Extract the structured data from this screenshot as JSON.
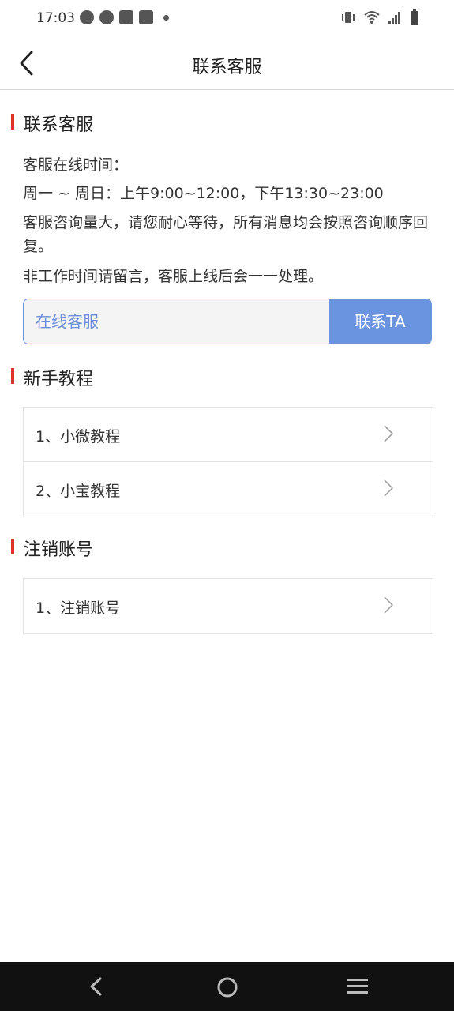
{
  "status_bar": {
    "time": "17:03"
  },
  "header": {
    "title": "联系客服"
  },
  "contact_section": {
    "title": "联系客服",
    "hours_label": "客服在线时间：",
    "hours_value": "周一 ~ 周日：上午9:00~12:00，下午13:30~23:00",
    "notice_1": "客服咨询量大，请您耐心等待，所有消息均会按照咨询顺序回复。",
    "notice_2": "非工作时间请留言，客服上线后会一一处理。",
    "input_placeholder": "在线客服",
    "button_label": "联系TA"
  },
  "tutorial_section": {
    "title": "新手教程",
    "items": [
      {
        "label": "1、小微教程"
      },
      {
        "label": "2、小宝教程"
      }
    ]
  },
  "cancel_section": {
    "title": "注销账号",
    "items": [
      {
        "label": "1、注销账号"
      }
    ]
  },
  "colors": {
    "accent_red": "#e0312d",
    "accent_blue": "#6b94e0"
  }
}
